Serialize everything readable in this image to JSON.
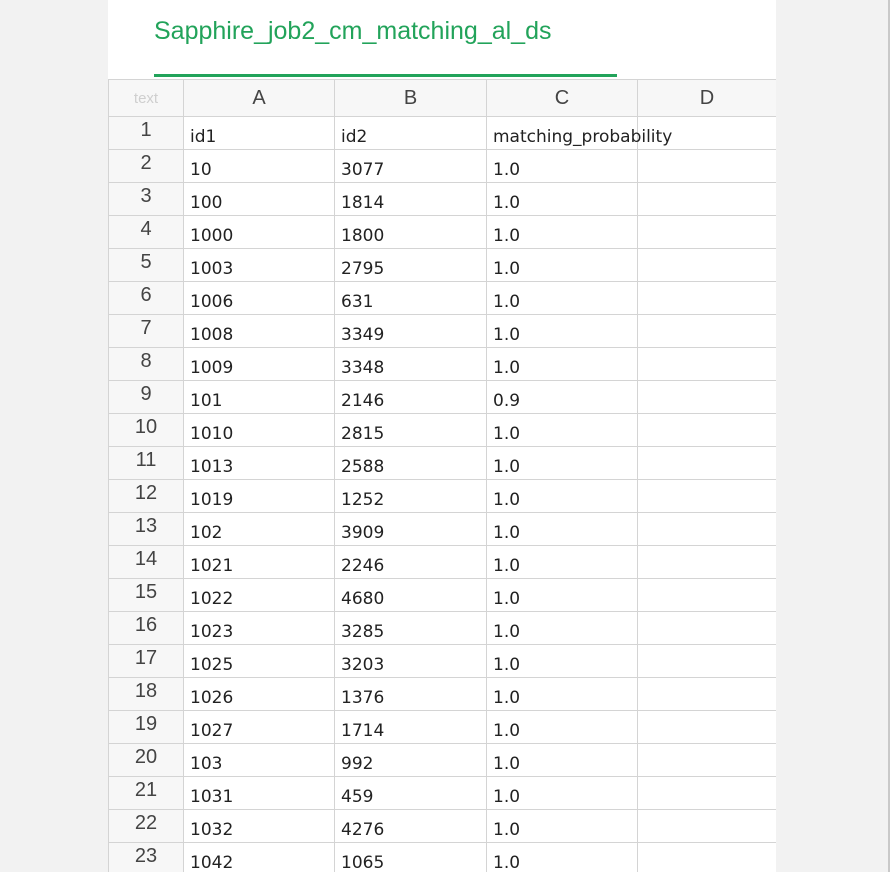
{
  "sheet_tab": {
    "label": "Sapphire_job2_cm_matching_al_ds"
  },
  "grid": {
    "corner_label": "text",
    "columns": [
      "A",
      "B",
      "C",
      "D"
    ],
    "rows": [
      {
        "num": "1",
        "a": "id1",
        "b": "id2",
        "c": "matching_probability",
        "d": ""
      },
      {
        "num": "2",
        "a": "10",
        "b": "3077",
        "c": "1.0",
        "d": ""
      },
      {
        "num": "3",
        "a": "100",
        "b": "1814",
        "c": "1.0",
        "d": ""
      },
      {
        "num": "4",
        "a": "1000",
        "b": "1800",
        "c": "1.0",
        "d": ""
      },
      {
        "num": "5",
        "a": "1003",
        "b": "2795",
        "c": "1.0",
        "d": ""
      },
      {
        "num": "6",
        "a": "1006",
        "b": "631",
        "c": "1.0",
        "d": ""
      },
      {
        "num": "7",
        "a": "1008",
        "b": "3349",
        "c": "1.0",
        "d": ""
      },
      {
        "num": "8",
        "a": "1009",
        "b": "3348",
        "c": "1.0",
        "d": ""
      },
      {
        "num": "9",
        "a": "101",
        "b": "2146",
        "c": "0.9",
        "d": ""
      },
      {
        "num": "10",
        "a": "1010",
        "b": "2815",
        "c": "1.0",
        "d": ""
      },
      {
        "num": "11",
        "a": "1013",
        "b": "2588",
        "c": "1.0",
        "d": ""
      },
      {
        "num": "12",
        "a": "1019",
        "b": "1252",
        "c": "1.0",
        "d": ""
      },
      {
        "num": "13",
        "a": "102",
        "b": "3909",
        "c": "1.0",
        "d": ""
      },
      {
        "num": "14",
        "a": "1021",
        "b": "2246",
        "c": "1.0",
        "d": ""
      },
      {
        "num": "15",
        "a": "1022",
        "b": "4680",
        "c": "1.0",
        "d": ""
      },
      {
        "num": "16",
        "a": "1023",
        "b": "3285",
        "c": "1.0",
        "d": ""
      },
      {
        "num": "17",
        "a": "1025",
        "b": "3203",
        "c": "1.0",
        "d": ""
      },
      {
        "num": "18",
        "a": "1026",
        "b": "1376",
        "c": "1.0",
        "d": ""
      },
      {
        "num": "19",
        "a": "1027",
        "b": "1714",
        "c": "1.0",
        "d": ""
      },
      {
        "num": "20",
        "a": "103",
        "b": "992",
        "c": "1.0",
        "d": ""
      },
      {
        "num": "21",
        "a": "1031",
        "b": "459",
        "c": "1.0",
        "d": ""
      },
      {
        "num": "22",
        "a": "1032",
        "b": "4276",
        "c": "1.0",
        "d": ""
      },
      {
        "num": "23",
        "a": "1042",
        "b": "1065",
        "c": "1.0",
        "d": ""
      }
    ]
  },
  "colors": {
    "accent": "#22a35a",
    "grid_line": "#d4d4d4",
    "header_bg": "#f7f7f7",
    "outer_bg": "#f2f2f2"
  }
}
